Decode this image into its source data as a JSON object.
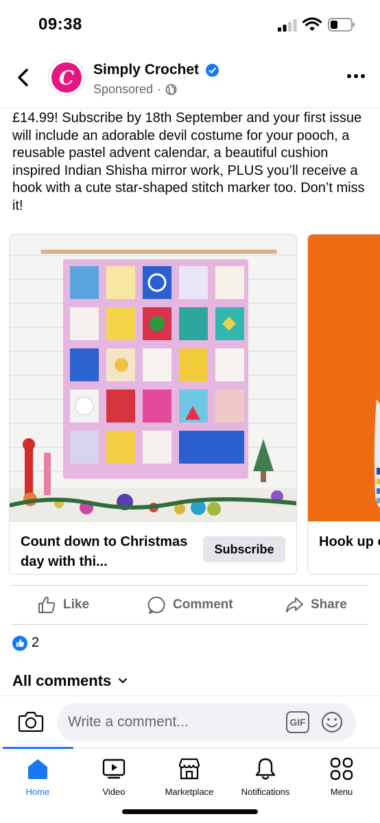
{
  "status_bar": {
    "time": "09:38"
  },
  "header": {
    "page_name": "Simply Crochet",
    "avatar_letter": "C",
    "sponsored": "Sponsored",
    "separator": "·",
    "verified_icon": "verified-badge-icon",
    "brand_color": "#e6157f"
  },
  "post": {
    "text": "£14.99! Subscribe by 18th September and your first issue will include an adorable devil costume for your pooch, a reusable pastel advent calendar, a beautiful cushion inspired Indian Shisha mirror work, PLUS you’ll receive a hook with a cute star-shaped stitch marker too. Don’t miss it!"
  },
  "carousel": {
    "cards": [
      {
        "headline": "Count down to Christmas day with thi...",
        "cta": "Subscribe"
      },
      {
        "headline": "Hook up cardie in"
      }
    ]
  },
  "actions": {
    "like": "Like",
    "comment": "Comment",
    "share": "Share"
  },
  "reactions": {
    "count": "2"
  },
  "comments": {
    "label": "All comments"
  },
  "composer": {
    "placeholder": "Write a comment...",
    "gif": "GIF"
  },
  "tabs": [
    {
      "label": "Home",
      "icon": "home-icon",
      "active": true
    },
    {
      "label": "Video",
      "icon": "video-icon"
    },
    {
      "label": "Marketplace",
      "icon": "marketplace-icon"
    },
    {
      "label": "Notifications",
      "icon": "bell-icon"
    },
    {
      "label": "Menu",
      "icon": "menu-grid-icon"
    }
  ],
  "colors": {
    "accent": "#1877f2",
    "secondary_text": "#65676b",
    "divider": "#dadde1"
  }
}
